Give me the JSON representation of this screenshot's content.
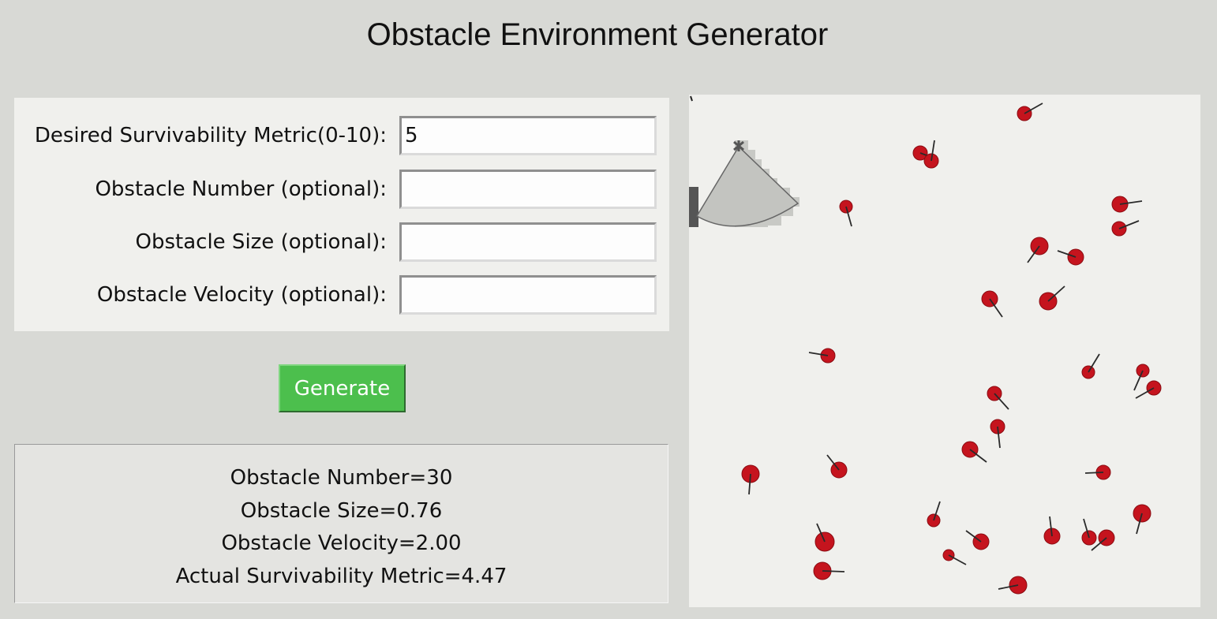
{
  "title": "Obstacle Environment Generator",
  "form": {
    "survivability_label": "Desired Survivability Metric(0-10):",
    "survivability_value": "5",
    "number_label": "Obstacle Number (optional):",
    "number_value": "",
    "size_label": "Obstacle Size (optional):",
    "size_value": "",
    "velocity_label": "Obstacle Velocity (optional):",
    "velocity_value": ""
  },
  "generate_label": "Generate",
  "results": {
    "number": "Obstacle Number=30",
    "size": "Obstacle Size=0.76",
    "velocity": "Obstacle Velocity=2.00",
    "survivability": "Actual Survivability Metric=4.47"
  },
  "colors": {
    "obstacle": "#c5141e",
    "button": "#4cbf4d",
    "sensor_fill": "#c3c4c0"
  }
}
